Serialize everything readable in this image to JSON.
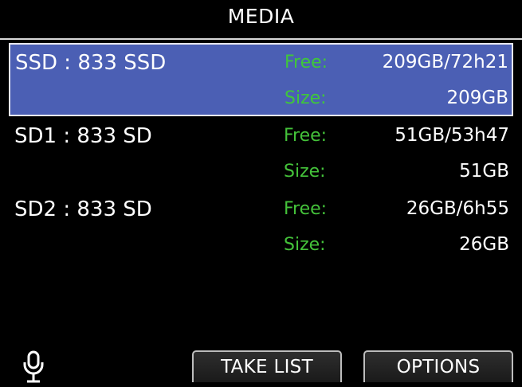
{
  "header": {
    "title": "MEDIA"
  },
  "labels": {
    "free": "Free:",
    "size": "Size:"
  },
  "media": [
    {
      "name": "SSD : 833 SSD",
      "free": "209GB/72h21",
      "size": "209GB",
      "selected": true
    },
    {
      "name": "SD1 : 833 SD",
      "free": "51GB/53h47",
      "size": "51GB",
      "selected": false
    },
    {
      "name": "SD2 : 833 SD",
      "free": "26GB/6h55",
      "size": "26GB",
      "selected": false
    }
  ],
  "footer": {
    "mic_icon": "microphone-icon",
    "take_list_label": "TAKE LIST",
    "options_label": "OPTIONS"
  },
  "colors": {
    "selected_bg": "#4b5fb4",
    "label_green": "#44c23a"
  }
}
